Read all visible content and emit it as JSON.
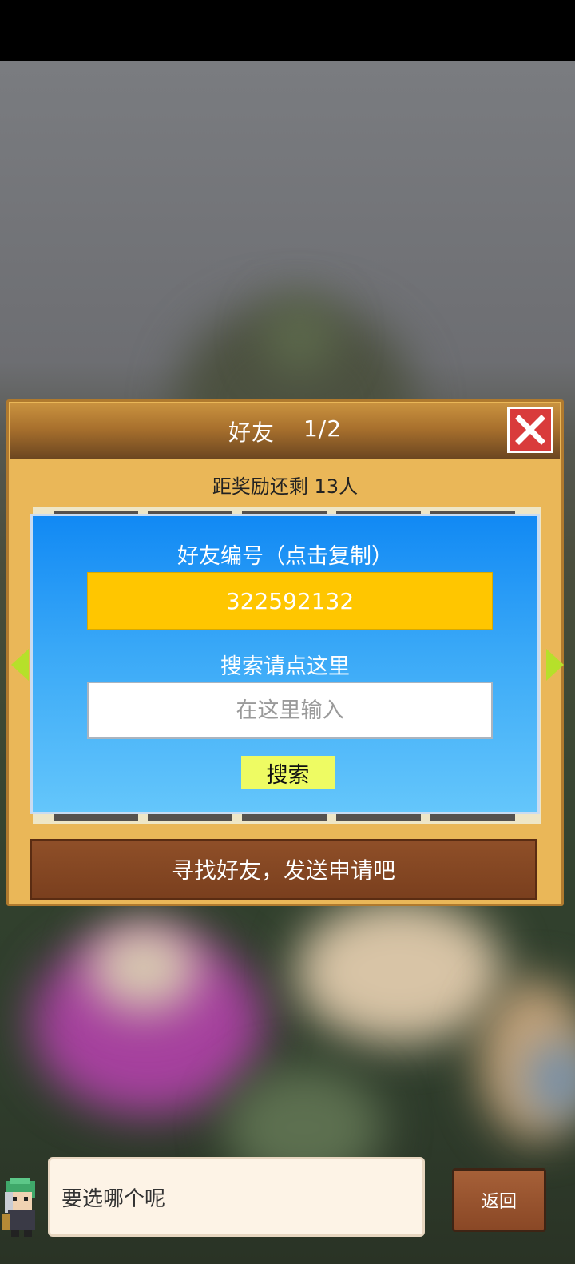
{
  "panel": {
    "title": "好友",
    "page_indicator": "1/2",
    "reward_text": "距奖励还剩 13人",
    "close_icon": "close-icon",
    "find_friends_label": "寻找好友，发送申请吧"
  },
  "modal": {
    "friend_id_label": "好友编号（点击复制）",
    "friend_id_value": "322592132",
    "search_label": "搜索请点这里",
    "search_placeholder": "在这里输入",
    "search_button_label": "搜索"
  },
  "dialog": {
    "text": "要选哪个呢",
    "back_label": "返回"
  },
  "colors": {
    "panel_bg": "#eab758",
    "modal_blue": "#1189f4",
    "id_box": "#ffc600",
    "search_button": "#eefb63",
    "close_red": "#d93b3b",
    "arrow_green": "#b6e02a"
  }
}
